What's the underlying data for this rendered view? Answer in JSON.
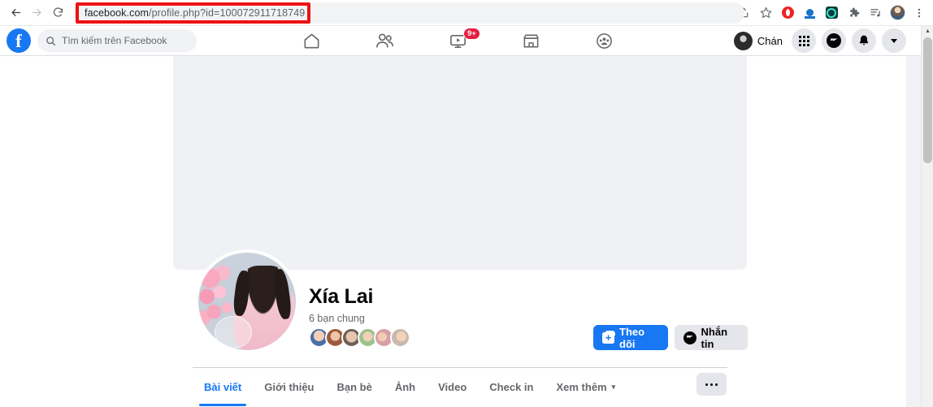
{
  "browser": {
    "back_icon": "arrow-left-icon",
    "forward_icon": "arrow-right-icon",
    "reload_icon": "reload-icon",
    "url_host": "facebook.com",
    "url_path": "/profile.php?id=100072911718749",
    "url_full": "facebook.com/profile.php?id=100072911718749",
    "toolbar_icons": [
      {
        "name": "share-icon",
        "glyph": "⤴"
      },
      {
        "name": "bookmark-star-icon",
        "glyph": "☆"
      },
      {
        "name": "opera-extension-icon",
        "glyph": ""
      },
      {
        "name": "blue-extension-icon",
        "glyph": ""
      },
      {
        "name": "teal-extension-icon",
        "glyph": ""
      },
      {
        "name": "puzzle-extensions-icon",
        "glyph": "❖"
      },
      {
        "name": "reading-list-icon",
        "glyph": "≡"
      },
      {
        "name": "chrome-profile-avatar",
        "glyph": ""
      },
      {
        "name": "chrome-menu-icon",
        "glyph": "⋮"
      }
    ],
    "annotation_color": "#ee1111"
  },
  "fb_header": {
    "logo": "facebook-logo",
    "logo_letter": "f",
    "search_placeholder": "Tìm kiếm trên Facebook",
    "search_icon": "search-icon",
    "nav": [
      {
        "name": "home-tab",
        "icon": "home-icon",
        "badge": ""
      },
      {
        "name": "friends-tab",
        "icon": "friends-icon",
        "badge": ""
      },
      {
        "name": "video-tab",
        "icon": "video-icon",
        "badge": "9+"
      },
      {
        "name": "marketplace-tab",
        "icon": "marketplace-icon",
        "badge": ""
      },
      {
        "name": "groups-tab",
        "icon": "groups-icon",
        "badge": ""
      }
    ],
    "account_name": "Chán",
    "right_icons": [
      {
        "name": "menu-grid-icon"
      },
      {
        "name": "messenger-icon"
      },
      {
        "name": "notifications-bell-icon"
      },
      {
        "name": "account-chevron-down-icon"
      }
    ]
  },
  "profile": {
    "cover_photo": "cover-photo",
    "profile_photo": "profile-photo",
    "name": "Xía Lai",
    "mutual_friends": "6 bạn chung",
    "mutual_avatar_count": 6,
    "buttons": {
      "follow_label": "Theo dõi",
      "follow_icon": "follow-person-icon",
      "message_label": "Nhắn tin",
      "message_icon": "messenger-icon"
    },
    "accent_color": "#1877f2"
  },
  "tabs": {
    "items": [
      {
        "label": "Bài viết",
        "active": true
      },
      {
        "label": "Giới thiệu",
        "active": false
      },
      {
        "label": "Bạn bè",
        "active": false
      },
      {
        "label": "Ảnh",
        "active": false
      },
      {
        "label": "Video",
        "active": false
      },
      {
        "label": "Check in",
        "active": false
      },
      {
        "label": "Xem thêm",
        "active": false,
        "caret": "▾"
      }
    ],
    "more_button": "···"
  },
  "scrollbar": {
    "up_arrow": "▲"
  }
}
